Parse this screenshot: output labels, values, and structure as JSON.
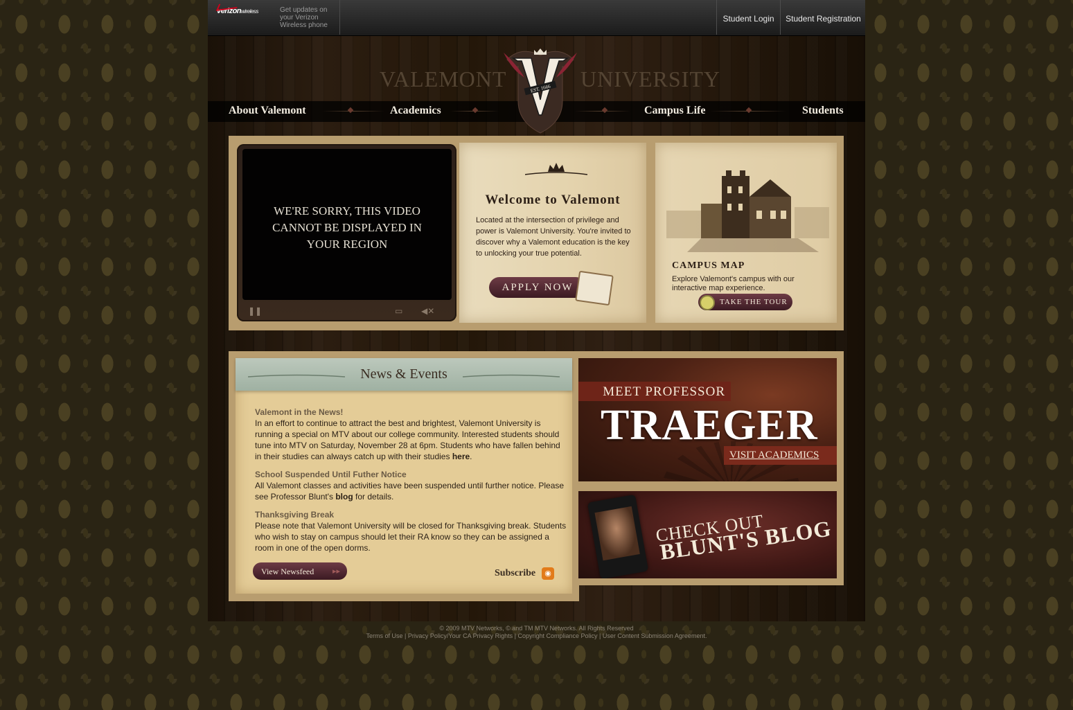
{
  "topbar": {
    "verizon": {
      "brand": "verizon",
      "brand_suffix": "wireless",
      "promo": "Get updates on your Verizon Wireless phone"
    },
    "links": [
      "Student Login",
      "Student Registration"
    ]
  },
  "header": {
    "title_left": "VALEMONT",
    "title_right": "UNIVERSITY",
    "crest_letter": "V",
    "crest_est": "EST. 1666"
  },
  "nav": [
    "About Valemont",
    "Academics",
    "Campus Life",
    "Students"
  ],
  "video": {
    "message": "WE'RE SORRY, THIS VIDEO CANNOT BE DISPLAYED IN YOUR REGION"
  },
  "welcome": {
    "title": "Welcome to Valemont",
    "body": "Located at the intersection of privilege and power is Valemont University. You're invited to discover why a Valemont education is the key to unlocking your true potential.",
    "apply_label": "APPLY NOW"
  },
  "campus_map": {
    "title": "CAMPUS MAP",
    "body": "Explore Valemont's campus with our interactive map experience.",
    "tour_label": "TAKE THE TOUR"
  },
  "news": {
    "title": "News & Events",
    "items": [
      {
        "heading": "Valemont in the News!",
        "text": "In an effort to continue to attract the best and brightest, Valemont University is running a special on MTV about our college community. Interested students should tune into MTV on Saturday, November 28 at 6pm. Students who have fallen behind in their studies can always catch up with their studies ",
        "link": "here",
        "after": "."
      },
      {
        "heading": "School Suspended Until Futher Notice",
        "text": "All Valemont classes and activities have been suspended until further notice. Please see Professor Blunt's ",
        "link": "blog",
        "after": " for details."
      },
      {
        "heading": "Thanksgiving Break",
        "text": "Please note that Valemont University will be closed for Thanksgiving break. Students who wish to stay on campus should let their RA know so they can be assigned a room in one of the open dorms."
      }
    ],
    "newsfeed_label": "View Newsfeed",
    "subscribe_label": "Subscribe"
  },
  "promo_traeger": {
    "kicker": "MEET PROFESSOR",
    "name": "TRAEGER",
    "link": "VISIT ACADEMICS"
  },
  "promo_blog": {
    "line1": "CHECK OUT",
    "line2": "BLUNT'S BLOG"
  },
  "footer": {
    "copyright": "© 2009 MTV Networks, © and TM MTV Networks. All Rights Reserved",
    "links": [
      "Terms of Use",
      "Privacy Policy/Your CA Privacy Rights",
      "Copyright Compliance Policy",
      "User Content Submission Agreement."
    ]
  },
  "colors": {
    "button_maroon": "#4f2530",
    "panel_tan": "#b89d6f",
    "nav_text": "#f2ece0",
    "accent_red": "#7a2a1c"
  }
}
